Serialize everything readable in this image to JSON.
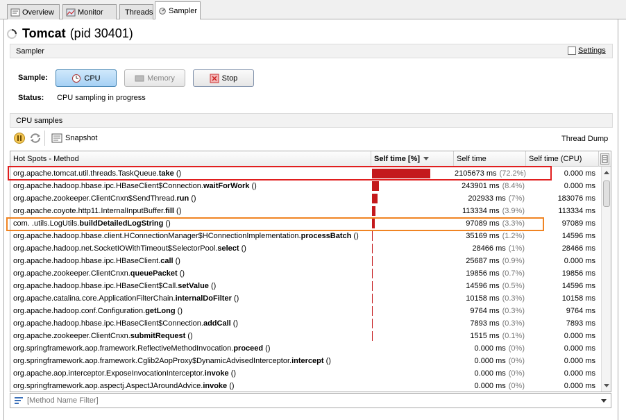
{
  "tabs": [
    {
      "label": "Overview",
      "icon": "overview-icon"
    },
    {
      "label": "Monitor",
      "icon": "monitor-icon"
    },
    {
      "label": "Threads",
      "icon": "threads-icon"
    },
    {
      "label": "Sampler",
      "icon": "sampler-icon"
    }
  ],
  "header": {
    "app_name": "Tomcat",
    "pid_text": "(pid 30401)"
  },
  "sampler_section": {
    "title": "Sampler",
    "settings_label": "Settings",
    "settings_checked": false
  },
  "sample": {
    "label": "Sample:",
    "cpu_button": "CPU",
    "memory_button": "Memory",
    "stop_button": "Stop",
    "status_label": "Status:",
    "status_value": "CPU sampling in progress"
  },
  "cpu_samples": {
    "title": "CPU samples",
    "snapshot_label": "Snapshot",
    "thread_dump_label": "Thread Dump"
  },
  "table": {
    "columns": [
      "Hot Spots - Method",
      "Self time [%]",
      "Self time",
      "Self time (CPU)"
    ],
    "rows": [
      {
        "prefix": "org.apache.tomcat.util.threads.TaskQueue.",
        "method": "take",
        "suffix": " ()",
        "bar": 0.722,
        "self_time": "2105673 ms",
        "pct": "(72.2%)",
        "cpu": "0.000 ms"
      },
      {
        "prefix": "org.apache.hadoop.hbase.ipc.HBaseClient$Connection.",
        "method": "waitForWork",
        "suffix": " ()",
        "bar": 0.084,
        "self_time": "243901 ms",
        "pct": "(8.4%)",
        "cpu": "0.000 ms"
      },
      {
        "prefix": "org.apache.zookeeper.ClientCnxn$SendThread.",
        "method": "run",
        "suffix": " ()",
        "bar": 0.07,
        "self_time": "202933 ms",
        "pct": "(7%)",
        "cpu": "183076 ms"
      },
      {
        "prefix": "org.apache.coyote.http11.InternalInputBuffer.",
        "method": "fill",
        "suffix": " ()",
        "bar": 0.039,
        "self_time": "113334 ms",
        "pct": "(3.9%)",
        "cpu": "113334 ms"
      },
      {
        "prefix": "com.            .utils.LogUtils.",
        "method": "buildDetailedLogString",
        "suffix": " ()",
        "bar": 0.033,
        "self_time": "97089 ms",
        "pct": "(3.3%)",
        "cpu": "97089 ms"
      },
      {
        "prefix": "org.apache.hadoop.hbase.client.HConnectionManager$HConnectionImplementation.",
        "method": "processBatch",
        "suffix": " ()",
        "bar": 0.012,
        "self_time": "35169 ms",
        "pct": "(1.2%)",
        "cpu": "14596 ms"
      },
      {
        "prefix": "org.apache.hadoop.net.SocketIOWithTimeout$SelectorPool.",
        "method": "select",
        "suffix": " ()",
        "bar": 0.01,
        "self_time": "28466 ms",
        "pct": "(1%)",
        "cpu": "28466 ms"
      },
      {
        "prefix": "org.apache.hadoop.hbase.ipc.HBaseClient.",
        "method": "call",
        "suffix": " ()",
        "bar": 0.009,
        "self_time": "25687 ms",
        "pct": "(0.9%)",
        "cpu": "0.000 ms"
      },
      {
        "prefix": "org.apache.zookeeper.ClientCnxn.",
        "method": "queuePacket",
        "suffix": " ()",
        "bar": 0.007,
        "self_time": "19856 ms",
        "pct": "(0.7%)",
        "cpu": "19856 ms"
      },
      {
        "prefix": "org.apache.hadoop.hbase.ipc.HBaseClient$Call.",
        "method": "setValue",
        "suffix": " ()",
        "bar": 0.005,
        "self_time": "14596 ms",
        "pct": "(0.5%)",
        "cpu": "14596 ms"
      },
      {
        "prefix": "org.apache.catalina.core.ApplicationFilterChain.",
        "method": "internalDoFilter",
        "suffix": " ()",
        "bar": 0.003,
        "self_time": "10158 ms",
        "pct": "(0.3%)",
        "cpu": "10158 ms"
      },
      {
        "prefix": "org.apache.hadoop.conf.Configuration.",
        "method": "getLong",
        "suffix": " ()",
        "bar": 0.003,
        "self_time": "9764 ms",
        "pct": "(0.3%)",
        "cpu": "9764 ms"
      },
      {
        "prefix": "org.apache.hadoop.hbase.ipc.HBaseClient$Connection.",
        "method": "addCall",
        "suffix": " ()",
        "bar": 0.003,
        "self_time": "7893 ms",
        "pct": "(0.3%)",
        "cpu": "7893 ms"
      },
      {
        "prefix": "org.apache.zookeeper.ClientCnxn.",
        "method": "submitRequest",
        "suffix": " ()",
        "bar": 0.001,
        "self_time": "1515 ms",
        "pct": "(0.1%)",
        "cpu": "0.000 ms"
      },
      {
        "prefix": "org.springframework.aop.framework.ReflectiveMethodInvocation.",
        "method": "proceed",
        "suffix": " ()",
        "bar": 0,
        "self_time": "0.000 ms",
        "pct": "(0%)",
        "cpu": "0.000 ms"
      },
      {
        "prefix": "org.springframework.aop.framework.Cglib2AopProxy$DynamicAdvisedInterceptor.",
        "method": "intercept",
        "suffix": " ()",
        "bar": 0,
        "self_time": "0.000 ms",
        "pct": "(0%)",
        "cpu": "0.000 ms"
      },
      {
        "prefix": "org.apache.aop.interceptor.ExposeInvocationInterceptor.",
        "method": "invoke",
        "suffix": " ()",
        "bar": 0,
        "self_time": "0.000 ms",
        "pct": "(0%)",
        "cpu": "0.000 ms"
      },
      {
        "prefix": "org.springframework.aop.aspectj.AspectJAroundAdvice.",
        "method": "invoke",
        "suffix": " ()",
        "bar": 0,
        "self_time": "0.000 ms",
        "pct": "(0%)",
        "cpu": "0.000 ms"
      }
    ]
  },
  "filter": {
    "placeholder": "[Method Name Filter]"
  },
  "colors": {
    "bar": "#c4191c",
    "highlight_top": "#e01e1e",
    "highlight_selected": "#f08422"
  }
}
